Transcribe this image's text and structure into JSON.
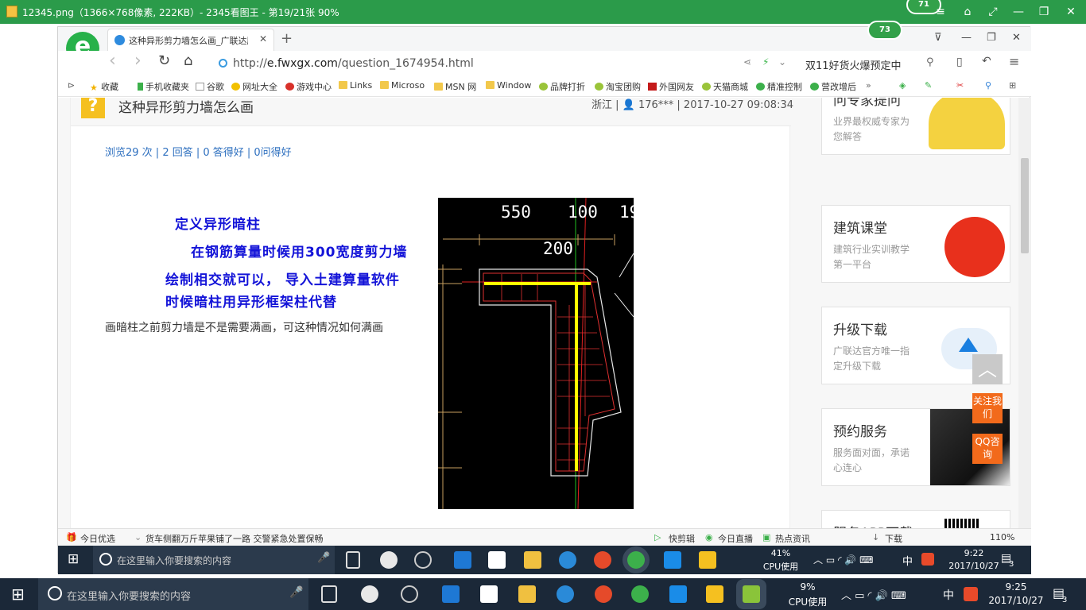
{
  "outer_window": {
    "title": "12345.png（1366×768像素, 222KB）- 2345看图王 - 第19/21张 90%",
    "badge": "71",
    "controls": [
      "≡",
      "⌂",
      "⤢",
      "—",
      "❐",
      "✕"
    ]
  },
  "browser": {
    "badge": "73",
    "tab_title": "这种异形剪力墙怎么画_广联达服",
    "new_tab": "+",
    "logo": "e",
    "window_controls": [
      "⊽",
      "—",
      "❐",
      "✕"
    ],
    "nav": {
      "back": "‹",
      "forward": "›",
      "refresh": "↻",
      "home": "⌂"
    },
    "url_prefix": "http://",
    "url_domain": "e.fwxgx.com",
    "url_path": "/question_1674954.html",
    "search_text": "双11好货火爆预定中",
    "bookmarks": [
      "收藏",
      "手机收藏夹",
      "谷歌",
      "网址大全",
      "游戏中心",
      "Links",
      "Microso",
      "MSN 网",
      "Window",
      "品牌打折",
      "淘宝团购",
      "外国网友",
      "天猫商城",
      "精准控制",
      "营改增后"
    ],
    "bookmarks_more": "»"
  },
  "question": {
    "icon": "?",
    "title": "这种异形剪力墙怎么画",
    "meta": "浙江 | 👤 176*** | 2017-10-27 09:08:34",
    "stats": "浏览29 次 | 2 回答 | 0 答得好 | 0问得好",
    "annot_line1": "定义异形暗柱",
    "annot_line2": "在钢筋算量时候用300宽度剪力墙",
    "annot_line3": "绘制相交就可以，  导入土建算量软件",
    "annot_line4": "时候暗柱用异形框架柱代替",
    "body": "画暗柱之前剪力墙是不是需要满画，可这种情况如何满画"
  },
  "cad": {
    "dim1": "550",
    "dim2": "100",
    "dim3": "19",
    "dim4": "200"
  },
  "sidebar": [
    {
      "title": "问专家提问",
      "desc": "业界最权威专家为您解答"
    },
    {
      "title": "建筑课堂",
      "desc": "建筑行业实训教学第一平台"
    },
    {
      "title": "升级下载",
      "desc": "广联达官方唯一指定升级下载"
    },
    {
      "title": "预约服务",
      "desc": "服务面对面，承诺心连心"
    },
    {
      "title": "服务APP下载",
      "desc": ""
    }
  ],
  "float_buttons": {
    "top": "︿",
    "follow": "关注我们",
    "qq": "QQ咨询"
  },
  "statusbar": {
    "left_label": "今日优选",
    "news": "货车侧翻万斤苹果铺了一路 交警紧急处置保畅",
    "items": [
      "快剪辑",
      "今日直播",
      "热点资讯"
    ],
    "download": "下载",
    "zoom": "110%"
  },
  "inner_taskbar": {
    "search_placeholder": "在这里输入你要搜索的内容",
    "cpu_pct": "41%",
    "cpu_label": "CPU使用",
    "ime": "中",
    "time": "9:22",
    "date": "2017/10/27",
    "notif": "3"
  },
  "outer_taskbar": {
    "search_placeholder": "在这里输入你要搜索的内容",
    "cpu_pct": "9%",
    "cpu_label": "CPU使用",
    "ime": "中",
    "time": "9:25",
    "date": "2017/10/27",
    "notif": "3"
  },
  "colors": {
    "accent_green": "#2b9b4a",
    "annotation_blue": "#1414d8",
    "link_blue": "#2d6fbf",
    "taskbar": "#1b2838"
  }
}
